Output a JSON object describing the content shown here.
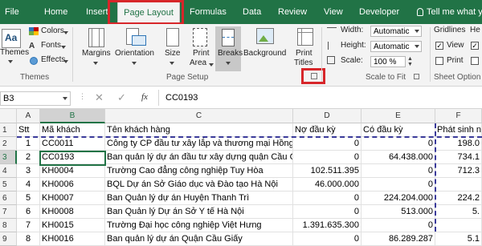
{
  "tabs": [
    {
      "label": "File"
    },
    {
      "label": "Home"
    },
    {
      "label": "Insert"
    },
    {
      "label": "Page Layout"
    },
    {
      "label": "Formulas"
    },
    {
      "label": "Data"
    },
    {
      "label": "Review"
    },
    {
      "label": "View"
    },
    {
      "label": "Developer"
    },
    {
      "label": "Tell me what y"
    }
  ],
  "ribbon": {
    "themes_group": {
      "label": "Themes",
      "themes_btn": "Themes",
      "colors": "Colors",
      "fonts": "Fonts",
      "effects": "Effects"
    },
    "page_setup": {
      "label": "Page Setup",
      "margins": "Margins",
      "orientation": "Orientation",
      "size": "Size",
      "print_area_1": "Print",
      "print_area_2": "Area",
      "breaks": "Breaks",
      "background": "Background",
      "print_titles_1": "Print",
      "print_titles_2": "Titles"
    },
    "scale": {
      "label": "Scale to Fit",
      "width_label": "Width:",
      "width_value": "Automatic",
      "height_label": "Height:",
      "height_value": "Automatic",
      "scale_label": "Scale:",
      "scale_value": "100 %"
    },
    "sheet_options": {
      "label": "Sheet Option",
      "gridlines": "Gridlines",
      "view": "View",
      "print": "Print",
      "headings": "He"
    }
  },
  "formula_bar": {
    "name_box": "B3",
    "fx": "fx",
    "value": "CC0193"
  },
  "columns": [
    "A",
    "B",
    "C",
    "D",
    "E",
    "F"
  ],
  "rows": [
    {
      "n": "1",
      "a": "Stt",
      "b": "Mã khách",
      "c": "Tên khách hàng",
      "d": "Nợ đầu kỳ",
      "e": "Có đầu kỳ",
      "f": "Phát sinh nợ"
    },
    {
      "n": "2",
      "a": "1",
      "b": "CC0011",
      "c": "Công ty CP đầu tư xây lắp và thương mại  Hồng",
      "d": "0",
      "e": "0",
      "f": "198.0"
    },
    {
      "n": "3",
      "a": "2",
      "b": "CC0193",
      "c": "Ban quản lý dự án đầu tư xây dựng quận Cầu G",
      "d": "0",
      "e": "64.438.000",
      "f": "734.1"
    },
    {
      "n": "4",
      "a": "3",
      "b": "KH0004",
      "c": "Trường Cao đẳng công nghiệp Tuy Hòa",
      "d": "102.511.395",
      "e": "0",
      "f": "712.3"
    },
    {
      "n": "5",
      "a": "4",
      "b": "KH0006",
      "c": "BQL Dự án Sở Giáo dục và Đào tạo Hà Nội",
      "d": "46.000.000",
      "e": "0",
      "f": ""
    },
    {
      "n": "6",
      "a": "5",
      "b": "KH0007",
      "c": "Ban Quản lý dự án Huyện Thanh Trì",
      "d": "0",
      "e": "224.204.000",
      "f": "224.2"
    },
    {
      "n": "7",
      "a": "6",
      "b": "KH0008",
      "c": "Ban Quản lý Dự án Sở Y tế Hà Nội",
      "d": "0",
      "e": "513.000",
      "f": "5."
    },
    {
      "n": "8",
      "a": "7",
      "b": "KH0015",
      "c": "Trường Đại học công nghiệp Việt Hưng",
      "d": "1.391.635.300",
      "e": "0",
      "f": ""
    },
    {
      "n": "9",
      "a": "8",
      "b": "KH0016",
      "c": "Ban quản lý dự án Quận Cầu Giấy",
      "d": "0",
      "e": "86.289.287",
      "f": "5.1"
    }
  ],
  "colors": {
    "brand": "#217346",
    "highlight": "#d7262a"
  }
}
